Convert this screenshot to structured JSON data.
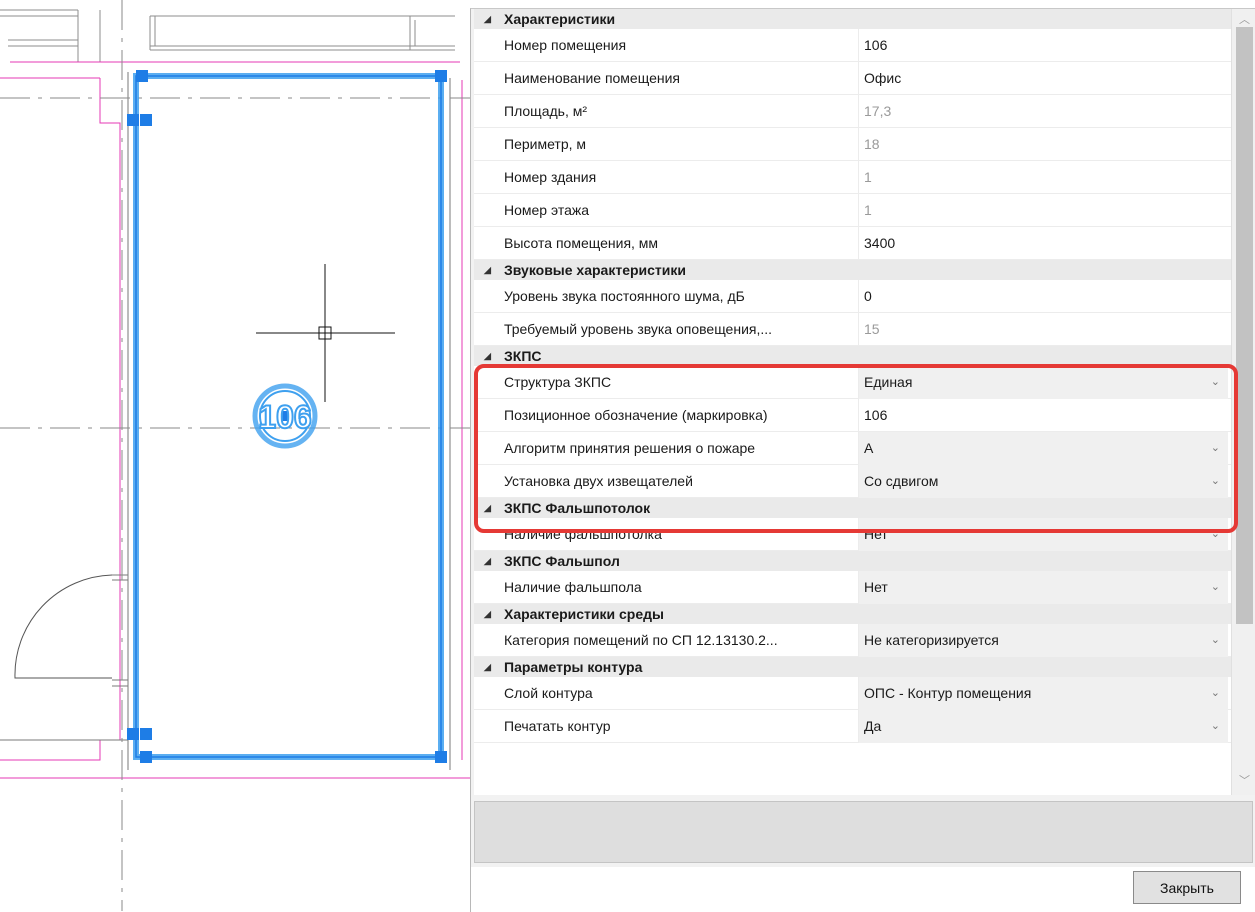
{
  "room_tag": "106",
  "colors": {
    "selection": "#3ea0ef",
    "grip": "#1e7de6",
    "wall": "#e53ab5",
    "highlight": "#e53935"
  },
  "properties": {
    "categories": [
      {
        "title": "Характеристики",
        "rows": [
          {
            "name": "Номер помещения",
            "value": "106",
            "readonly": false,
            "dropdown": false
          },
          {
            "name": "Наименование помещения",
            "value": "Офис",
            "readonly": false,
            "dropdown": false
          },
          {
            "name": "Площадь, м²",
            "value": "17,3",
            "readonly": true,
            "dropdown": false
          },
          {
            "name": "Периметр, м",
            "value": "18",
            "readonly": true,
            "dropdown": false
          },
          {
            "name": "Номер здания",
            "value": "1",
            "readonly": true,
            "dropdown": false
          },
          {
            "name": "Номер этажа",
            "value": "1",
            "readonly": true,
            "dropdown": false
          },
          {
            "name": "Высота помещения, мм",
            "value": "3400",
            "readonly": false,
            "dropdown": false
          }
        ]
      },
      {
        "title": "Звуковые характеристики",
        "rows": [
          {
            "name": "Уровень звука постоянного шума, дБ",
            "value": "0",
            "readonly": false,
            "dropdown": false
          },
          {
            "name": "Требуемый уровень звука оповещения,...",
            "value": "15",
            "readonly": true,
            "dropdown": false
          }
        ]
      },
      {
        "title": "ЗКПС",
        "rows": [
          {
            "name": "Структура ЗКПС",
            "value": "Единая",
            "readonly": false,
            "dropdown": true
          },
          {
            "name": "Позиционное обозначение (маркировка)",
            "value": "106",
            "readonly": false,
            "dropdown": false
          },
          {
            "name": "Алгоритм принятия решения о пожаре",
            "value": "А",
            "readonly": false,
            "dropdown": true
          },
          {
            "name": "Установка двух извещателей",
            "value": "Со сдвигом",
            "readonly": false,
            "dropdown": true
          }
        ]
      },
      {
        "title": "ЗКПС Фальшпотолок",
        "rows": [
          {
            "name": "Наличие фальшпотолка",
            "value": "Нет",
            "readonly": false,
            "dropdown": true
          }
        ]
      },
      {
        "title": "ЗКПС Фальшпол",
        "rows": [
          {
            "name": "Наличие фальшпола",
            "value": "Нет",
            "readonly": false,
            "dropdown": true
          }
        ]
      },
      {
        "title": "Характеристики среды",
        "rows": [
          {
            "name": "Категория помещений по СП 12.13130.2...",
            "value": "Не категоризируется",
            "readonly": false,
            "dropdown": true
          }
        ]
      },
      {
        "title": "Параметры контура",
        "rows": [
          {
            "name": "Слой контура",
            "value": "ОПС - Контур помещения",
            "readonly": false,
            "dropdown": true
          },
          {
            "name": "Печатать контур",
            "value": "Да",
            "readonly": false,
            "dropdown": true
          }
        ]
      }
    ]
  },
  "close_label": "Закрыть"
}
